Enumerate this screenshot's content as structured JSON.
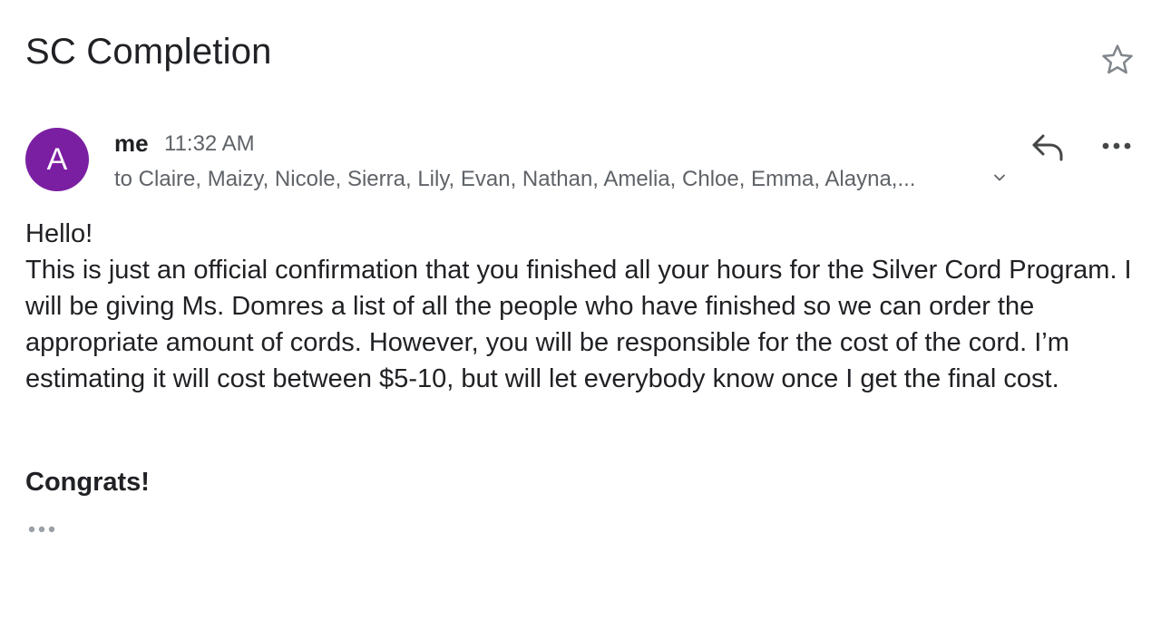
{
  "email": {
    "subject": "SC Completion",
    "sender": {
      "avatar_letter": "A",
      "avatar_color": "#7b1fa2",
      "name": "me",
      "time": "11:32 AM"
    },
    "recipients": "to Claire, Maizy, Nicole, Sierra, Lily, Evan, Nathan, Amelia, Chloe, Emma, Alayna,...",
    "body": {
      "greeting": "Hello!",
      "paragraph": "This is just an official confirmation that you finished all your hours for the Silver Cord Program. I will be giving Ms. Domres a list of all the people who have finished so we can order the appropriate amount of cords. However, you will be responsible for the cost of the cord. I’m estimating it will cost between $5-10, but will let everybody know once I get the final cost.",
      "signoff": "Congrats!"
    }
  },
  "icons": {
    "star": "star-outline-icon",
    "reply": "reply-icon",
    "more": "more-horizontal-icon",
    "expand": "chevron-down-icon",
    "trimmed": "trimmed-content-icon"
  }
}
